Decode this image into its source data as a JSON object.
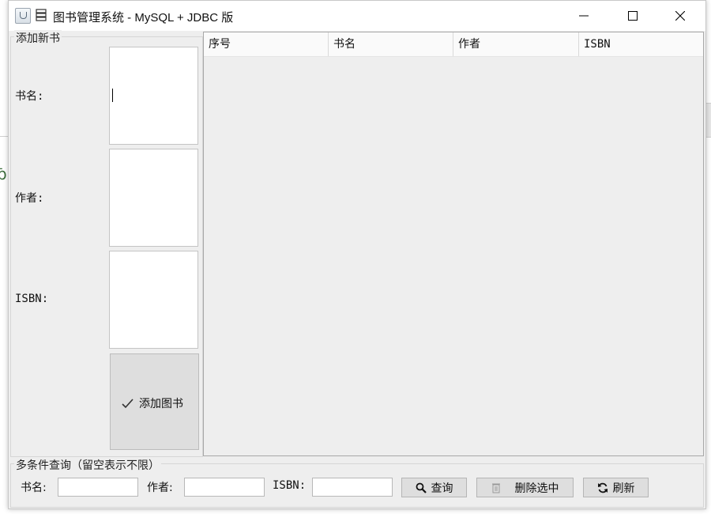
{
  "window": {
    "title": "图书管理系统 - MySQL + JDBC 版",
    "app_icon": "java-cup-icon",
    "title_icon": "book-stack-icon"
  },
  "add_panel": {
    "title": "添加新书",
    "fields": [
      {
        "label": "书名:",
        "value": ""
      },
      {
        "label": "作者:",
        "value": ""
      },
      {
        "label": "ISBN:",
        "value": ""
      }
    ],
    "add_button": {
      "label": "添加图书",
      "icon": "check-icon"
    }
  },
  "table": {
    "columns": [
      "序号",
      "书名",
      "作者",
      "ISBN"
    ],
    "rows": []
  },
  "query_panel": {
    "title": "多条件查询（留空表示不限）",
    "labels": {
      "title": "书名:",
      "author": "作者:",
      "isbn": "ISBN:"
    },
    "values": {
      "title": "",
      "author": "",
      "isbn": ""
    },
    "buttons": {
      "search": {
        "label": "查询",
        "icon": "magnifier-icon"
      },
      "delete": {
        "label": "删除选中",
        "icon": "trash-icon"
      },
      "refresh": {
        "label": "刷新",
        "icon": "refresh-icon"
      }
    }
  }
}
